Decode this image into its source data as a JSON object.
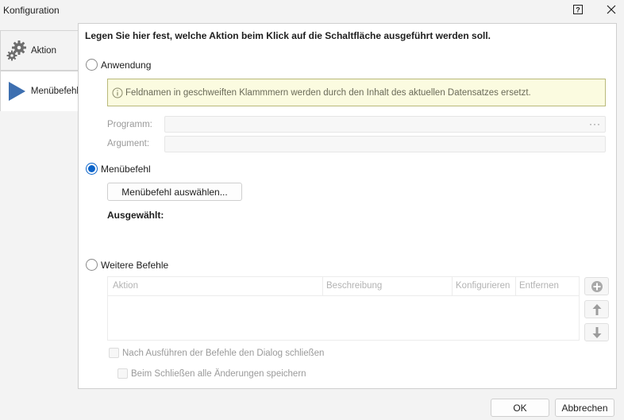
{
  "window": {
    "title": "Konfiguration",
    "help_symbol": "?",
    "close_symbol": "✕"
  },
  "sidebar": {
    "items": [
      {
        "label": "Aktion",
        "icon": "gears-icon"
      },
      {
        "label": "Menübefehl",
        "icon": "play-icon"
      }
    ]
  },
  "main": {
    "heading": "Legen Sie hier fest, welche Aktion beim Klick auf die Schaltfläche ausgeführt werden soll.",
    "option_application": {
      "label": "Anwendung",
      "info": "Feldnamen in geschweiften Klammmern werden durch den Inhalt des aktuellen Datensatzes ersetzt.",
      "program_label": "Programm:",
      "program_value": "",
      "program_browse": "···",
      "argument_label": "Argument:",
      "argument_value": ""
    },
    "option_menu": {
      "label": "Menübefehl",
      "select_button": "Menübefehl auswählen...",
      "selected_label": "Ausgewählt:"
    },
    "option_more": {
      "label": "Weitere Befehle",
      "columns": [
        "Aktion",
        "Beschreibung",
        "Konfigurieren",
        "Entfernen"
      ],
      "close_after": "Nach Ausführen der Befehle den Dialog schließen",
      "save_on_close": "Beim Schließen alle Änderungen speichern"
    },
    "selected_option": "Menübefehl"
  },
  "footer": {
    "ok": "OK",
    "cancel": "Abbrechen"
  },
  "colors": {
    "accent": "#0a63c9",
    "info_bg": "#fbfbe0",
    "info_border": "#b9b97a",
    "play_icon": "#3d6fb0"
  }
}
